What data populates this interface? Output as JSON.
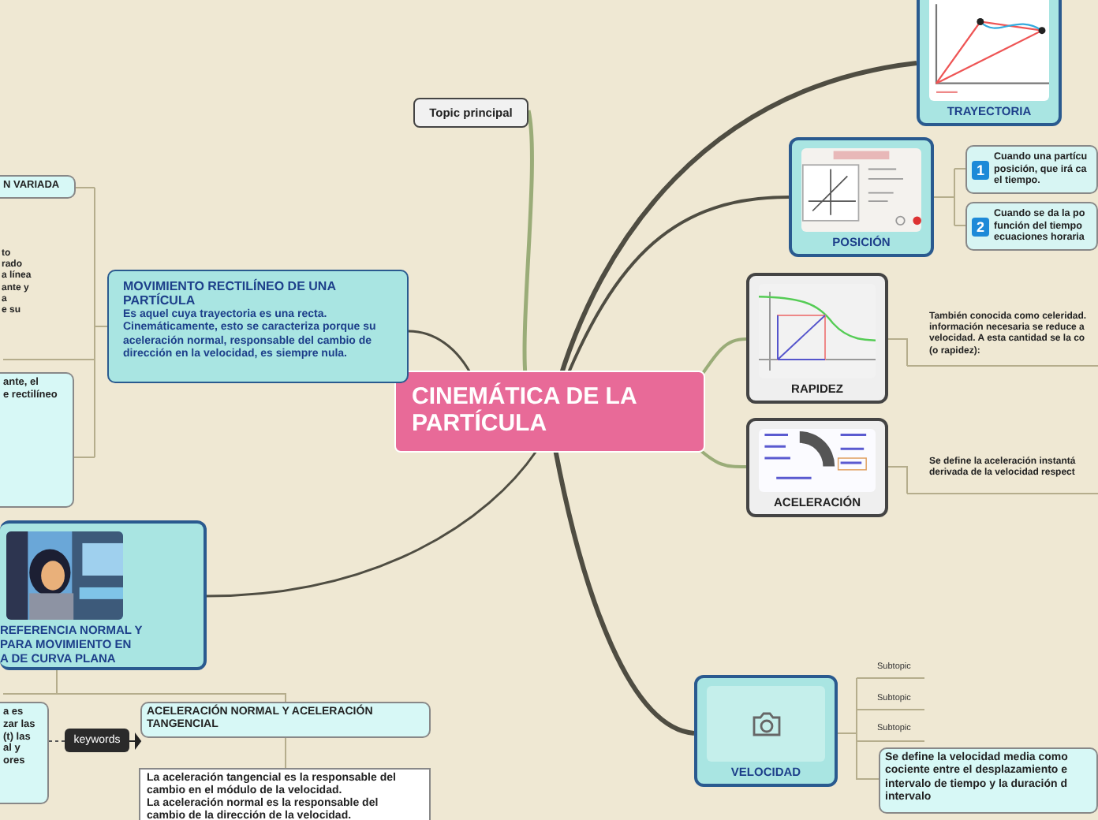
{
  "nodes": [
    {
      "kind": "topic",
      "title": "Topic principal"
    },
    {
      "kind": "image_card",
      "color": "#a9e5e2",
      "title": "TRAYECTORIA"
    },
    {
      "kind": "image_card",
      "color": "#a9e5e2",
      "title": "POSICIÓN"
    },
    {
      "kind": "numbered",
      "number": "1",
      "lines": [
        "Cuando una partícu",
        "posición, que irá ca",
        "el tiempo."
      ]
    },
    {
      "kind": "numbered",
      "number": "2",
      "lines": [
        "Cuando se da la po",
        "función del tiempo",
        "ecuaciones horaria"
      ]
    },
    {
      "kind": "image_card",
      "color": "#efefef",
      "title": "RAPIDEZ"
    },
    {
      "kind": "plain",
      "lines": [
        "También conocida como celeridad.",
        "información necesaria se reduce a",
        "velocidad. A esta cantidad se la co",
        "(o rapidez):"
      ]
    },
    {
      "kind": "image_card",
      "color": "#efefef",
      "title": "ACELERACIÓN"
    },
    {
      "kind": "plain",
      "lines": [
        "Se define la aceleración instantá",
        "derivada de la velocidad respect"
      ]
    },
    {
      "kind": "central",
      "title": "CINEMÁTICA DE LA PARTÍCULA"
    },
    {
      "kind": "title_card",
      "title": "MOVIMIENTO RECTILÍNEO DE UNA PARTÍCULA",
      "body": "Es aquel cuya trayectoria es una recta. Cinemáticamente, esto se caracteriza porque su aceleración normal, responsable del cambio de dirección en la velocidad, es siempre nula."
    },
    {
      "kind": "card",
      "lines": [
        "N VARIADA"
      ]
    },
    {
      "kind": "plain",
      "lines": [
        "to",
        "rado",
        "a línea",
        "ante y",
        "a",
        "e su"
      ]
    },
    {
      "kind": "card",
      "lines": [
        "ante, el",
        "e rectilíneo"
      ]
    },
    {
      "kind": "image_card",
      "color": "#a9e5e2",
      "title": "REFERENCIA NORMAL Y\nPARA MOVIMIENTO EN\nA DE CURVA PLANA"
    },
    {
      "kind": "card",
      "lines": [
        "a es",
        "zar las",
        "(t) las",
        "al y",
        "ores"
      ]
    },
    {
      "kind": "label",
      "title": "keywords"
    },
    {
      "kind": "card",
      "lines": [
        "ACELERACIÓN NORMAL Y ACELERACIÓN",
        "TANGENCIAL"
      ]
    },
    {
      "kind": "note",
      "lines": [
        "La aceleración tangencial es la responsable del",
        "cambio en el módulo de la velocidad.",
        "La aceleración normal es la responsable del",
        "cambio de la dirección de la velocidad."
      ]
    },
    {
      "kind": "image_card",
      "color": "#a9e5e2",
      "title": "VELOCIDAD",
      "image": {
        "kind": "placeholder"
      }
    },
    {
      "kind": "subtopic",
      "title": "Subtopic"
    },
    {
      "kind": "subtopic",
      "title": "Subtopic"
    },
    {
      "kind": "subtopic",
      "title": "Subtopic"
    },
    {
      "kind": "card",
      "lines": [
        "Se define la velocidad media como",
        "cociente entre el desplazamiento e",
        "intervalo de tiempo y la duración d",
        "intervalo"
      ]
    }
  ]
}
